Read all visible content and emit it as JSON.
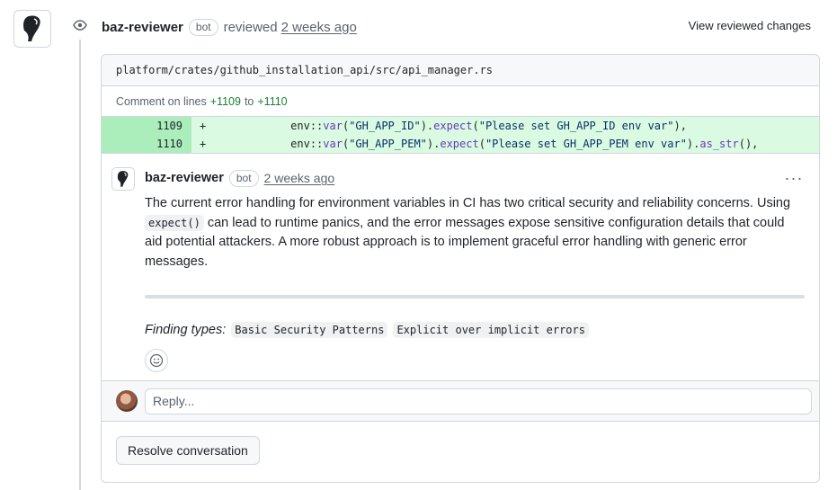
{
  "review": {
    "author": "baz-reviewer",
    "badge": "bot",
    "action": "reviewed",
    "time": "2 weeks ago",
    "view_changes_label": "View reviewed changes"
  },
  "file": {
    "path": "platform/crates/github_installation_api/src/api_manager.rs",
    "comment_on_prefix": "Comment on lines",
    "start_line": "+1109",
    "to_word": "to",
    "end_line": "+1110"
  },
  "diff": {
    "lines": [
      {
        "num": "1109",
        "sign": "+",
        "indent": "             ",
        "t1": "env::",
        "f1": "var",
        "t2": "(",
        "s1": "\"GH_APP_ID\"",
        "t3": ").",
        "f2": "expect",
        "t4": "(",
        "s2": "\"Please set GH_APP_ID env var\"",
        "t5": "),"
      },
      {
        "num": "1110",
        "sign": "+",
        "indent": "             ",
        "t1": "env::",
        "f1": "var",
        "t2": "(",
        "s1": "\"GH_APP_PEM\"",
        "t3": ").",
        "f2": "expect",
        "t4": "(",
        "s2": "\"Please set GH_APP_PEM env var\"",
        "t5": ").",
        "f3": "as_str",
        "t6": "(),"
      }
    ]
  },
  "comment": {
    "author": "baz-reviewer",
    "badge": "bot",
    "time": "2 weeks ago",
    "more_label": "···",
    "body_before": "The current error handling for environment variables in CI has two critical security and reliability concerns. Using ",
    "body_code": "expect()",
    "body_after": " can lead to runtime panics, and the error messages expose sensitive configuration details that could aid potential attackers. A more robust approach is to implement graceful error handling with generic error messages.",
    "finding_label": "Finding types:",
    "findings": [
      "Basic Security Patterns",
      "Explicit over implicit errors"
    ]
  },
  "reply": {
    "placeholder": "Reply..."
  },
  "resolve_label": "Resolve conversation",
  "icons": {
    "main_avatar": "baz-logo-icon",
    "eye": "eye-icon",
    "emoji": "smiley-icon"
  }
}
